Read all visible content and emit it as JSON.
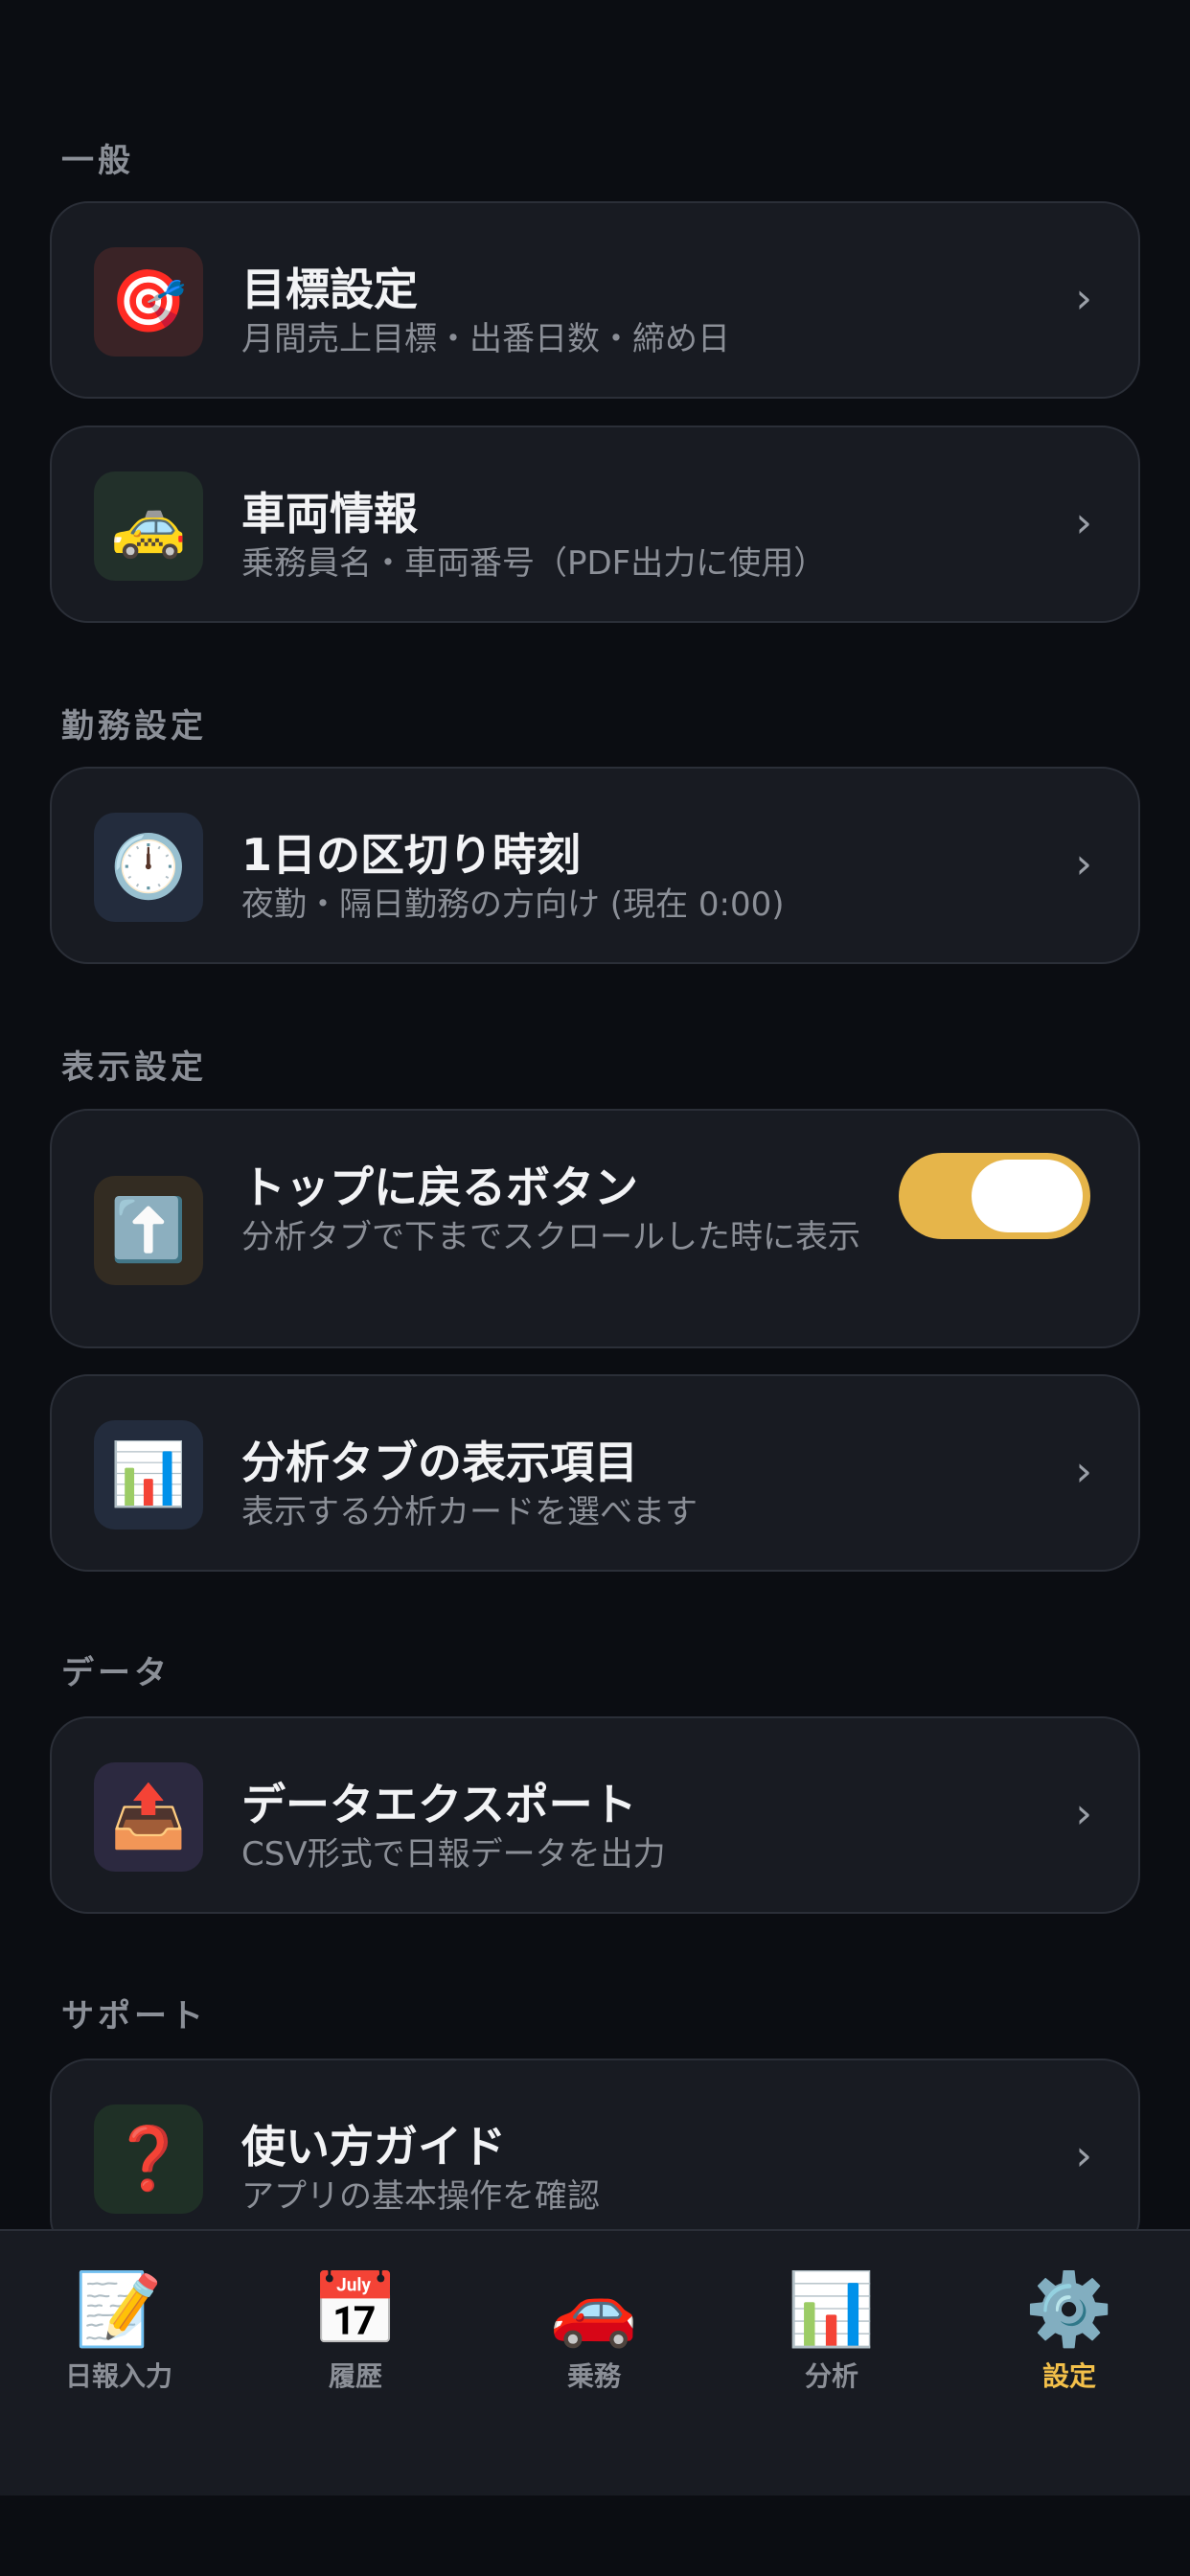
{
  "sections": {
    "general": "一般",
    "work": "勤務設定",
    "display": "表示設定",
    "data": "データ",
    "support": "サポート"
  },
  "items": {
    "goal": {
      "icon": "target-icon",
      "emoji": "🎯",
      "title": "目標設定",
      "subtitle": "月間売上目標・出番日数・締め日"
    },
    "vehicle": {
      "icon": "taxi-icon",
      "emoji": "🚕",
      "title": "車両情報",
      "subtitle": "乗務員名・車両番号（PDF出力に使用）"
    },
    "day_cutoff": {
      "icon": "clock-icon",
      "emoji": "🕛",
      "title": "1日の区切り時刻",
      "subtitle": "夜勤・隔日勤務の方向け (現在 0:00)"
    },
    "back_to_top": {
      "icon": "up-arrow-icon",
      "emoji": "⬆️",
      "title": "トップに戻るボタン",
      "subtitle": "分析タブで下までスクロールした時に表示",
      "toggle_on": true
    },
    "analysis_items": {
      "icon": "bar-chart-icon",
      "emoji": "📊",
      "title": "分析タブの表示項目",
      "subtitle": "表示する分析カードを選べます"
    },
    "export": {
      "icon": "outbox-tray-icon",
      "emoji": "📤",
      "title": "データエクスポート",
      "subtitle": "CSV形式で日報データを出力"
    },
    "guide": {
      "icon": "question-mark-icon",
      "emoji": "❓",
      "title": "使い方ガイド",
      "subtitle": "アプリの基本操作を確認"
    }
  },
  "chevron": "›",
  "tabs": [
    {
      "icon": "memo-icon",
      "emoji": "📝",
      "label": "日報入力",
      "active": false
    },
    {
      "icon": "calendar-icon",
      "emoji": "📅",
      "label": "履歴",
      "active": false
    },
    {
      "icon": "car-icon",
      "emoji": "🚗",
      "label": "乗務",
      "active": false
    },
    {
      "icon": "bar-chart-icon",
      "emoji": "📊",
      "label": "分析",
      "active": false
    },
    {
      "icon": "gear-icon",
      "emoji": "⚙️",
      "label": "設定",
      "active": true
    }
  ],
  "colors": {
    "background": "#0b0d12",
    "card": "#181b22",
    "accent": "#e6b54a",
    "active_tab": "#f3c04a",
    "muted_text": "#8b8f97"
  }
}
